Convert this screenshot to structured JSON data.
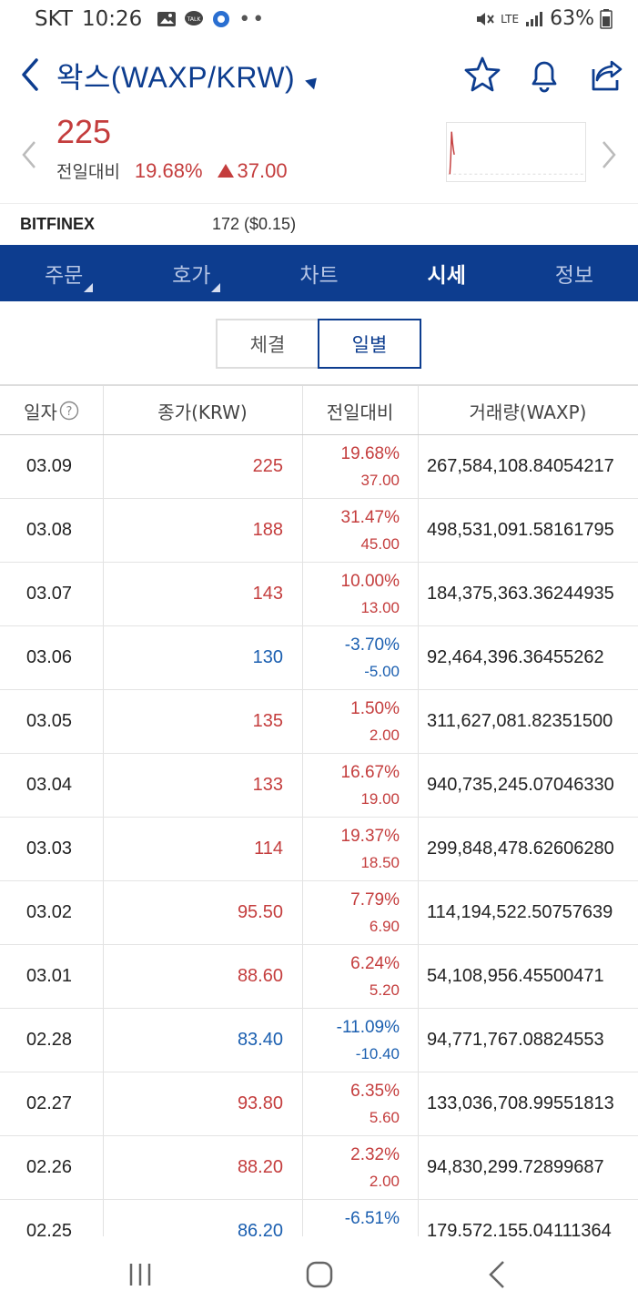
{
  "status_bar": {
    "carrier": "SKT",
    "time": "10:26",
    "network": "LTE",
    "battery": "63%"
  },
  "header": {
    "title": "왁스(WAXP/KRW)"
  },
  "price": {
    "current": "225",
    "change_label": "전일대비",
    "change_pct": "19.68%",
    "change_abs": "37.00",
    "direction": "up"
  },
  "exchange": {
    "name": "BITFINEX",
    "value": "172 ($0.15)"
  },
  "tabs": [
    {
      "label": "주문",
      "active": false,
      "has_submenu": true
    },
    {
      "label": "호가",
      "active": false,
      "has_submenu": true
    },
    {
      "label": "차트",
      "active": false,
      "has_submenu": false
    },
    {
      "label": "시세",
      "active": true,
      "has_submenu": false
    },
    {
      "label": "정보",
      "active": false,
      "has_submenu": false
    }
  ],
  "segment": {
    "options": [
      "체결",
      "일별"
    ],
    "selected": "일별"
  },
  "table": {
    "headers": [
      "일자",
      "종가(KRW)",
      "전일대비",
      "거래량(WAXP)"
    ],
    "rows": [
      {
        "date": "03.09",
        "close": "225",
        "pct": "19.68%",
        "diff": "37.00",
        "volume": "267,584,108.84054217",
        "dir": "up"
      },
      {
        "date": "03.08",
        "close": "188",
        "pct": "31.47%",
        "diff": "45.00",
        "volume": "498,531,091.58161795",
        "dir": "up"
      },
      {
        "date": "03.07",
        "close": "143",
        "pct": "10.00%",
        "diff": "13.00",
        "volume": "184,375,363.36244935",
        "dir": "up"
      },
      {
        "date": "03.06",
        "close": "130",
        "pct": "-3.70%",
        "diff": "-5.00",
        "volume": "92,464,396.36455262",
        "dir": "down"
      },
      {
        "date": "03.05",
        "close": "135",
        "pct": "1.50%",
        "diff": "2.00",
        "volume": "311,627,081.82351500",
        "dir": "up"
      },
      {
        "date": "03.04",
        "close": "133",
        "pct": "16.67%",
        "diff": "19.00",
        "volume": "940,735,245.07046330",
        "dir": "up"
      },
      {
        "date": "03.03",
        "close": "114",
        "pct": "19.37%",
        "diff": "18.50",
        "volume": "299,848,478.62606280",
        "dir": "up"
      },
      {
        "date": "03.02",
        "close": "95.50",
        "pct": "7.79%",
        "diff": "6.90",
        "volume": "114,194,522.50757639",
        "dir": "up"
      },
      {
        "date": "03.01",
        "close": "88.60",
        "pct": "6.24%",
        "diff": "5.20",
        "volume": "54,108,956.45500471",
        "dir": "up"
      },
      {
        "date": "02.28",
        "close": "83.40",
        "pct": "-11.09%",
        "diff": "-10.40",
        "volume": "94,771,767.08824553",
        "dir": "down"
      },
      {
        "date": "02.27",
        "close": "93.80",
        "pct": "6.35%",
        "diff": "5.60",
        "volume": "133,036,708.99551813",
        "dir": "up"
      },
      {
        "date": "02.26",
        "close": "88.20",
        "pct": "2.32%",
        "diff": "2.00",
        "volume": "94,830,299.72899687",
        "dir": "up"
      },
      {
        "date": "02.25",
        "close": "86.20",
        "pct": "-6.51%",
        "diff": "",
        "volume": "179,572,155.04111364",
        "dir": "down"
      }
    ]
  },
  "colors": {
    "brand_navy": "#0d3d8f",
    "up_red": "#c43d3d",
    "down_blue": "#1b5fb0"
  }
}
